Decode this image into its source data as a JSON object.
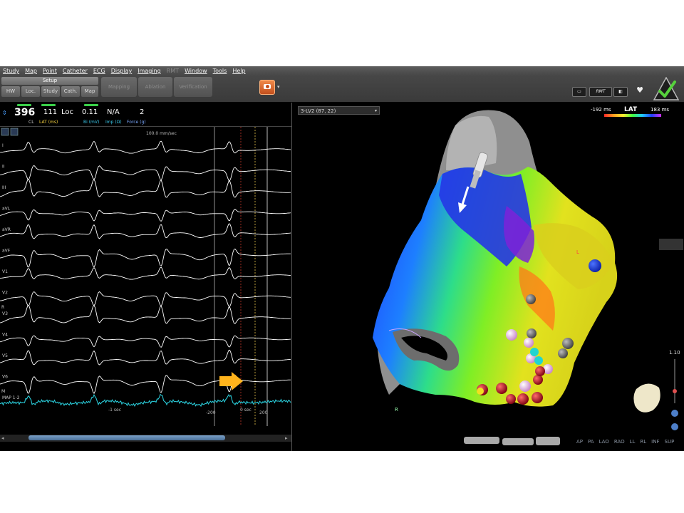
{
  "menu": [
    "Study",
    "Map",
    "Point",
    "Catheter",
    "ECG",
    "Display",
    "Imaging",
    "RMT",
    "Window",
    "Tools",
    "Help"
  ],
  "menu_disabled": [
    "RMT"
  ],
  "toolbar": {
    "setup": "Setup",
    "sub_buttons": [
      "HW",
      "Loc.",
      "Study",
      "Cath.",
      "Map"
    ],
    "phases": [
      "Mapping",
      "Ablation",
      "Verification"
    ],
    "rmt_label": "RMT"
  },
  "status": {
    "cl_value": "396",
    "cl_label": "CL",
    "lat_value": "111",
    "lat_label": "LAT (ms)",
    "loc_value": "Loc",
    "bi_value": "0.11",
    "bi_label": "Bi (mV)",
    "imp_value": "N/A",
    "imp_label": "Imp (Ω)",
    "force_value": "2",
    "force_label": "Force (g)"
  },
  "ecg": {
    "sweep_label": "100.0 mm/sec",
    "leads": [
      "I",
      "II",
      "III",
      "aVL",
      "aVR",
      "aVF",
      "V1",
      "V2",
      "V3",
      "V4",
      "V5",
      "V6",
      "MAP 1-2"
    ],
    "extra_labels": [
      "R",
      "M"
    ],
    "time_labels": [
      "-1 sec",
      "0 sec",
      "-200",
      "200"
    ],
    "map_color": "#29c9d6",
    "trace_color": "#ffffff",
    "arrow_color": "#ffb41c"
  },
  "map3d": {
    "map_name": "3-LV2 (87, 22)",
    "lat_title": "LAT",
    "lat_min": "-192 ms",
    "lat_max": "183 ms",
    "zoom": "1.10",
    "marker_l": "L",
    "marker_r": "R",
    "views": [
      "AP",
      "PA",
      "LAO",
      "RAO",
      "LL",
      "RL",
      "INF",
      "SUP"
    ]
  }
}
